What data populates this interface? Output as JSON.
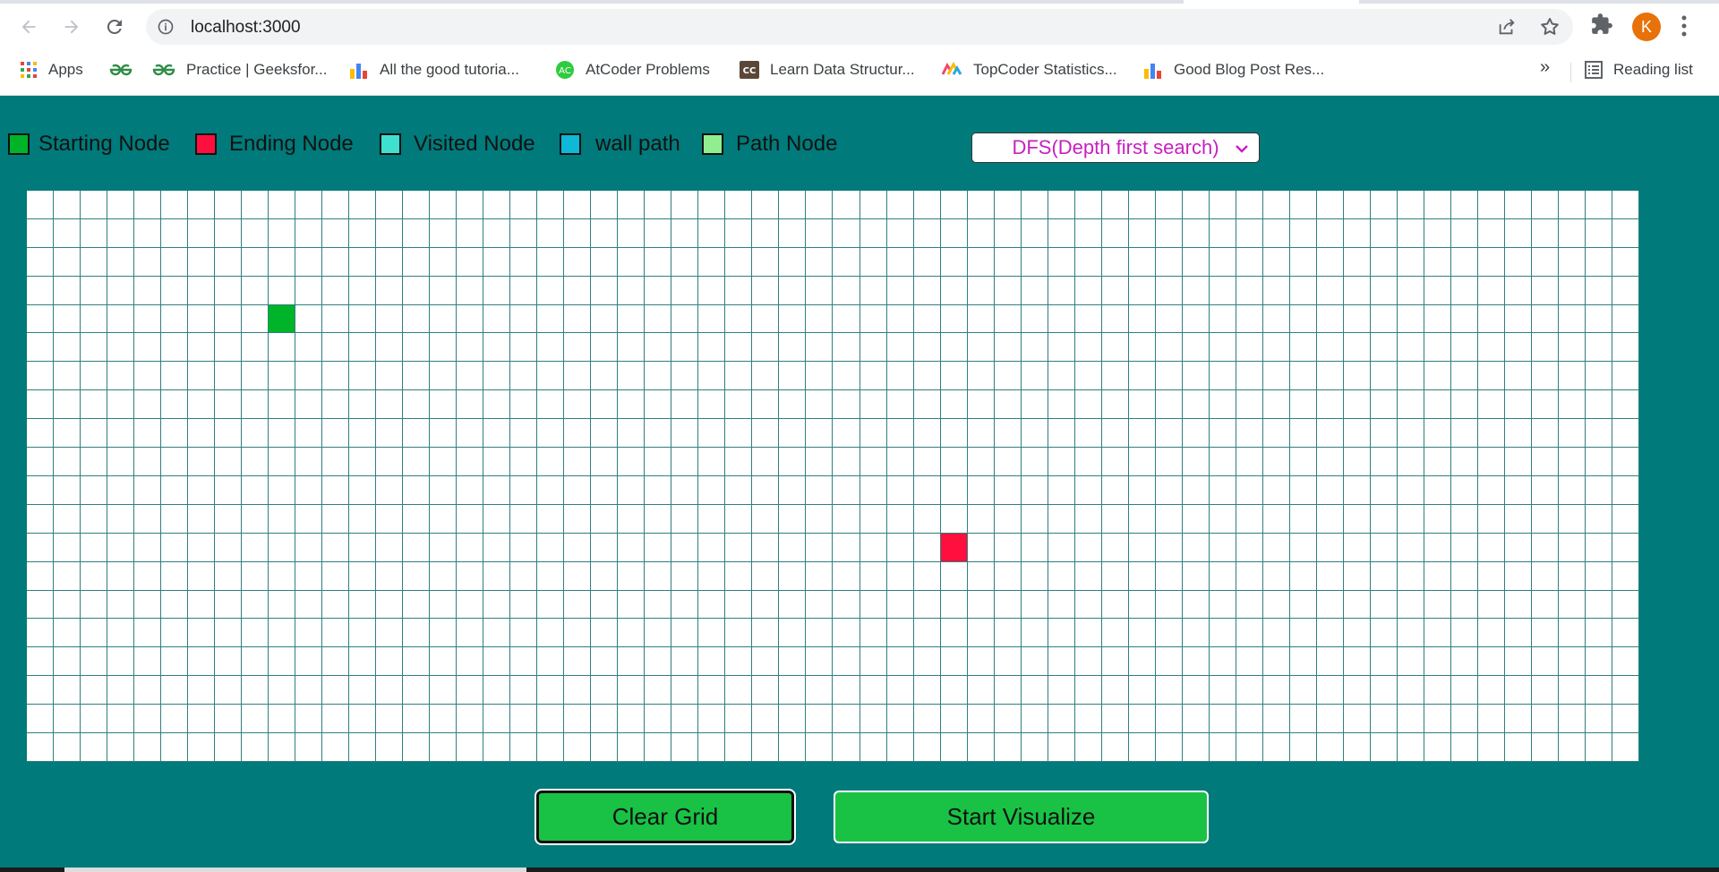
{
  "browser": {
    "url": "localhost:3000",
    "avatar_letter": "K",
    "bookmarks": [
      {
        "label": "Apps",
        "icon": "apps-grid-icon"
      },
      {
        "label": "",
        "icon": "geeksforgeeks-icon"
      },
      {
        "label": "Practice | Geeksfor...",
        "icon": "geeksforgeeks-icon"
      },
      {
        "label": "All the good tutoria...",
        "icon": "bar-chart-icon"
      },
      {
        "label": "AtCoder Problems",
        "icon": "atcoder-icon"
      },
      {
        "label": "Learn Data Structur...",
        "icon": "codechef-icon"
      },
      {
        "label": "TopCoder Statistics...",
        "icon": "topcoder-icon"
      },
      {
        "label": "Good Blog Post Res...",
        "icon": "bar-chart-icon"
      }
    ],
    "more_label": "»",
    "reading_list_label": "Reading list"
  },
  "legend": [
    {
      "label": "Starting Node",
      "color": "#00b42a"
    },
    {
      "label": "Ending Node",
      "color": "#ff0f3d"
    },
    {
      "label": "Visited Node",
      "color": "#40e0d0"
    },
    {
      "label": "wall path",
      "color": "#0fb8d6"
    },
    {
      "label": "Path Node",
      "color": "#90ee90"
    }
  ],
  "algorithm_select": {
    "value": "DFS(Depth first search)"
  },
  "grid": {
    "rows": 20,
    "cols": 60,
    "start": {
      "row": 4,
      "col": 9
    },
    "end": {
      "row": 12,
      "col": 34
    }
  },
  "buttons": {
    "clear": "Clear Grid",
    "start": "Start Visualize"
  }
}
